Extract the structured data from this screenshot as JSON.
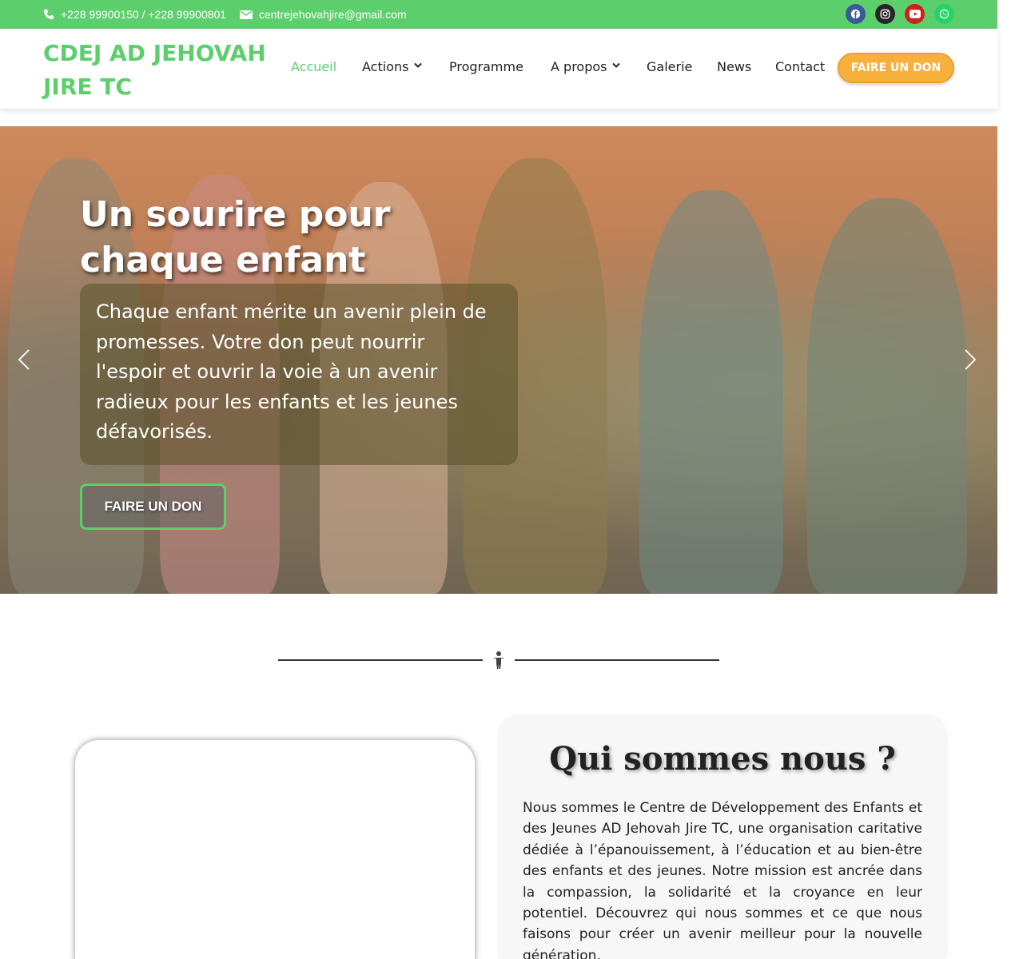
{
  "topbar": {
    "phone": "+228 99900150 / +228 99900801",
    "email": "centrejehovahjire@gmail.com",
    "social": [
      "facebook-icon",
      "instagram-icon",
      "youtube-icon",
      "whatsapp-icon"
    ]
  },
  "header": {
    "logo": "CDEJ AD JEHOVAH JIRE TC",
    "nav": [
      {
        "label": "Accueil",
        "active": true
      },
      {
        "label": "Actions",
        "dropdown": true
      },
      {
        "label": "Programme"
      },
      {
        "label": "A propos",
        "dropdown": true
      },
      {
        "label": "Galerie"
      },
      {
        "label": "News"
      },
      {
        "label": "Contact"
      }
    ],
    "donate": "FAIRE UN DON"
  },
  "hero": {
    "title": "Un sourire pour chaque enfant",
    "text": "Chaque enfant mérite un avenir plein de promesses. Votre don peut nourrir l'espoir et ouvrir la voie à un avenir radieux pour les enfants et les jeunes défavorisés.",
    "button": "FAIRE UN DON"
  },
  "about": {
    "title": "Qui sommes nous ?",
    "text": "Nous sommes le Centre de Développement des Enfants et des Jeunes AD Jehovah Jire TC, une organisation caritative dédiée à l’épanouissement, à l’éducation et au bien-être des enfants et des jeunes. Notre mission est ancrée dans la compassion, la solidarité et la croyance en leur potentiel. Découvrez qui nous sommes et ce que nous faisons pour créer un avenir meilleur pour la nouvelle génération."
  },
  "colors": {
    "brand_green": "#5ccf6c",
    "donate_orange": "#f8b03d"
  }
}
